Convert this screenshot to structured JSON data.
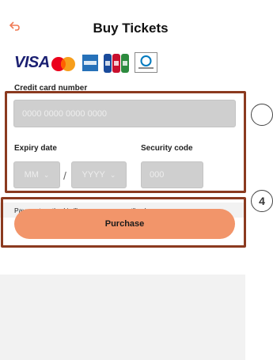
{
  "header": {
    "title": "Buy Tickets"
  },
  "payment": {
    "logos": {
      "visa": "VISA"
    },
    "card_number_label": "Credit card number",
    "card_number_placeholder": "0000 0000 0000 0000",
    "expiry_label": "Expiry date",
    "month_placeholder": "MM",
    "year_placeholder": "YYYY",
    "date_separator": "/",
    "security_label": "Security code",
    "security_placeholder": "000",
    "note": "Payment method is \"lump sum payment\" only.",
    "purchase_label": "Purchase"
  },
  "callouts": {
    "form": "",
    "purchase": "4"
  },
  "colors": {
    "accent": "#f2956a",
    "highlight": "#8b3a1f",
    "back": "#f07a54"
  }
}
